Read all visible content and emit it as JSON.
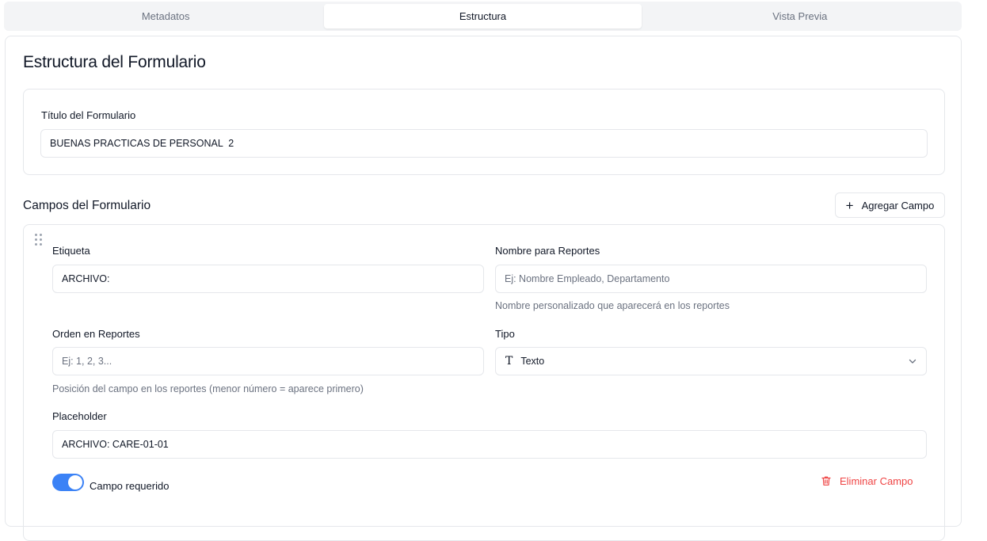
{
  "tabs": [
    {
      "label": "Metadatos"
    },
    {
      "label": "Estructura"
    },
    {
      "label": "Vista Previa"
    }
  ],
  "active_tab": "Estructura",
  "page_title": "Estructura del Formulario",
  "form_title": {
    "label": "Título del Formulario",
    "value": "BUENAS PRACTICAS DE PERSONAL  2"
  },
  "fields_section": {
    "title": "Campos del Formulario",
    "add_button": "Agregar Campo"
  },
  "field": {
    "label_field": {
      "label": "Etiqueta",
      "value": "ARCHIVO:"
    },
    "report_name": {
      "label": "Nombre para Reportes",
      "placeholder": "Ej: Nombre Empleado, Departamento",
      "hint": "Nombre personalizado que aparecerá en los reportes"
    },
    "report_order": {
      "label": "Orden en Reportes",
      "placeholder": "Ej: 1, 2, 3...",
      "hint": "Posición del campo en los reportes (menor número = aparece primero)"
    },
    "type": {
      "label": "Tipo",
      "value": "Texto",
      "icon": "T"
    },
    "placeholder": {
      "label": "Placeholder",
      "value": "ARCHIVO: CARE-01-01"
    },
    "required": {
      "label": "Campo requerido",
      "checked": true
    },
    "delete_button": "Eliminar Campo"
  },
  "colors": {
    "accent": "#3b82f6",
    "danger": "#ef4444"
  }
}
